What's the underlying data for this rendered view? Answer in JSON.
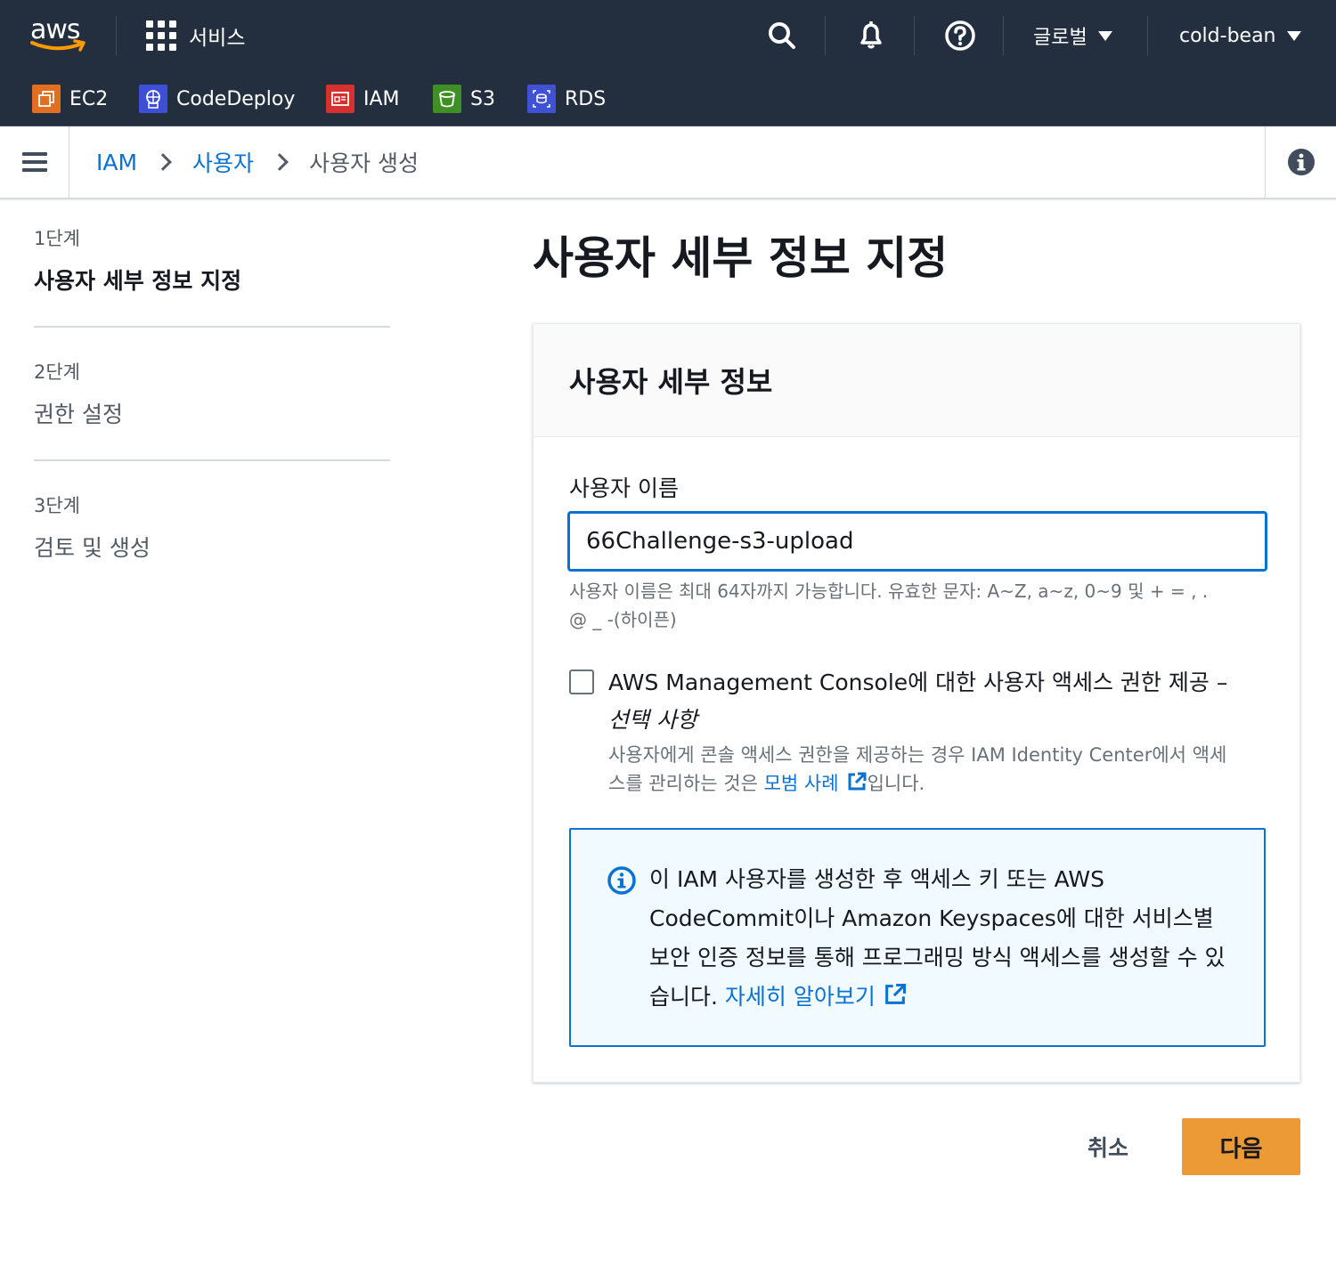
{
  "header": {
    "logo": "aws",
    "services_label": "서비스",
    "region": "글로벌",
    "account": "cold-bean",
    "icons": [
      "search-icon",
      "bell-icon",
      "help-icon"
    ]
  },
  "shortcuts": [
    {
      "label": "EC2",
      "icon": "ec2-icon",
      "color": "#e26f1f"
    },
    {
      "label": "CodeDeploy",
      "icon": "codedeploy-icon",
      "color": "#3c4fd6"
    },
    {
      "label": "IAM",
      "icon": "iam-icon",
      "color": "#d6302f"
    },
    {
      "label": "S3",
      "icon": "s3-icon",
      "color": "#3f8f24"
    },
    {
      "label": "RDS",
      "icon": "rds-icon",
      "color": "#4051d6"
    }
  ],
  "breadcrumb": {
    "items": [
      "IAM",
      "사용자",
      "사용자 생성"
    ]
  },
  "steps": [
    {
      "number": "1단계",
      "title": "사용자 세부 정보 지정",
      "active": true
    },
    {
      "number": "2단계",
      "title": "권한 설정",
      "active": false
    },
    {
      "number": "3단계",
      "title": "검토 및 생성",
      "active": false
    }
  ],
  "main": {
    "page_title": "사용자 세부 정보 지정",
    "container_title": "사용자 세부 정보",
    "username_label": "사용자 이름",
    "username_value": "66Challenge-s3-upload",
    "username_hint_1": "사용자 이름은 최대 64자까지 가능합니다. 유효한 문자: A~Z, a~z, 0~9 및 + = , .",
    "username_hint_2": "@ _ -(하이픈)",
    "console_access_label": "AWS Management Console에 대한 사용자 액세스 권한 제공 –",
    "console_access_optional": "선택 사항",
    "console_access_desc_1": "사용자에게 콘솔 액세스 권한을 제공하는 경우 IAM Identity Center에서 액세",
    "console_access_desc_2": "스를 관리하는 것은 ",
    "console_access_link": "모범 사례",
    "console_access_desc_3": "입니다.",
    "console_access_checked": false,
    "info_text": "이 IAM 사용자를 생성한 후 액세스 키 또는 AWS CodeCommit이나 Amazon Keyspaces에 대한 서비스별 보안 인증 정보를 통해 프로그래밍 방식 액세스를 생성할 수 있습니다. ",
    "info_link": "자세히 알아보기"
  },
  "footer": {
    "cancel_label": "취소",
    "next_label": "다음"
  },
  "colors": {
    "nav_bg": "#232f3e",
    "link": "#0972d3",
    "primary_button": "#ec9a35",
    "info_bg": "#f1faff"
  }
}
